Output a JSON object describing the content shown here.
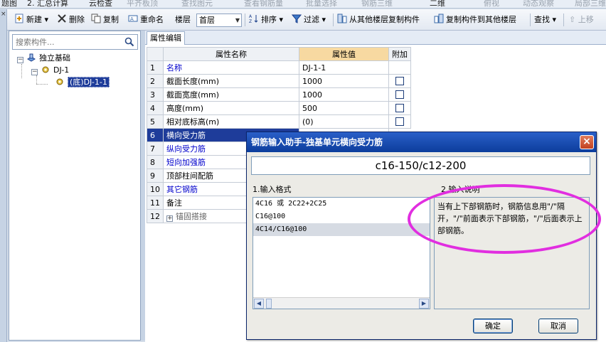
{
  "top_strip": {
    "items": [
      "题图",
      "2. 汇总计算",
      "云检查",
      "平齐板顶",
      "查找图元",
      "查看钢筋量",
      "批量选择",
      "钢筋三维",
      "二维",
      "俯视",
      "动态观察",
      "局部三维"
    ]
  },
  "toolbar": {
    "new_label": "新建",
    "delete_label": "删除",
    "copy_label": "复制",
    "rename_label": "重命名",
    "floor_label": "楼层",
    "floor_value": "首层",
    "sort_label": "排序",
    "filter_label": "过滤",
    "copy_from_label": "从其他楼层复制构件",
    "copy_to_label": "复制构件到其他楼层",
    "find_label": "查找",
    "up_label": "上移"
  },
  "left_pane": {
    "search_placeholder": "搜索构件...",
    "tree": {
      "root": "独立基础",
      "child": "DJ-1",
      "leaf": "(底)DJ-1-1"
    }
  },
  "property_editor": {
    "tab_label": "属性编辑",
    "headers": {
      "name": "属性名称",
      "value": "属性值",
      "extra": "附加"
    },
    "rows": [
      {
        "num": "1",
        "name": "名称",
        "value": "DJ-1-1",
        "blue": true,
        "checkbox": false
      },
      {
        "num": "2",
        "name": "截面长度(mm)",
        "value": "1000",
        "blue": false,
        "checkbox": true
      },
      {
        "num": "3",
        "name": "截面宽度(mm)",
        "value": "1000",
        "blue": false,
        "checkbox": true
      },
      {
        "num": "4",
        "name": "高度(mm)",
        "value": "500",
        "blue": false,
        "checkbox": true
      },
      {
        "num": "5",
        "name": "相对底标高(m)",
        "value": "(0)",
        "blue": false,
        "checkbox": true
      },
      {
        "num": "6",
        "name": "横向受力筋",
        "value": "",
        "blue": true,
        "checkbox": false
      },
      {
        "num": "7",
        "name": "纵向受力筋",
        "value": "",
        "blue": true,
        "checkbox": false
      },
      {
        "num": "8",
        "name": "短向加强筋",
        "value": "",
        "blue": true,
        "checkbox": false
      },
      {
        "num": "9",
        "name": "顶部柱间配筋",
        "value": "",
        "blue": false,
        "checkbox": false
      },
      {
        "num": "10",
        "name": "其它钢筋",
        "value": "",
        "blue": true,
        "checkbox": false
      },
      {
        "num": "11",
        "name": "备注",
        "value": "",
        "blue": false,
        "checkbox": false
      },
      {
        "num": "12",
        "name": "锚固搭接",
        "value": "",
        "blue": false,
        "checkbox": false
      }
    ]
  },
  "dialog": {
    "title": "钢筋输入助手-独基单元横向受力筋",
    "formula": "c16-150/c12-200",
    "format_label": "1.输入格式",
    "desc_label": "2.输入说明",
    "formats": [
      "4C16 或 2C22+2C25",
      "C16@100",
      "4C14/C16@100"
    ],
    "description": "当有上下部钢筋时，钢筋信息用\"/\"隔开，\"/\"前面表示下部钢筋，\"/\"后面表示上部钢筋。",
    "ok_label": "确定",
    "cancel_label": "取消"
  },
  "colors": {
    "selection": "#1e3c9a",
    "title_bar": "#0c3d9c",
    "highlight_ellipse": "#e12ee0",
    "value_header": "#f7d9a1"
  }
}
